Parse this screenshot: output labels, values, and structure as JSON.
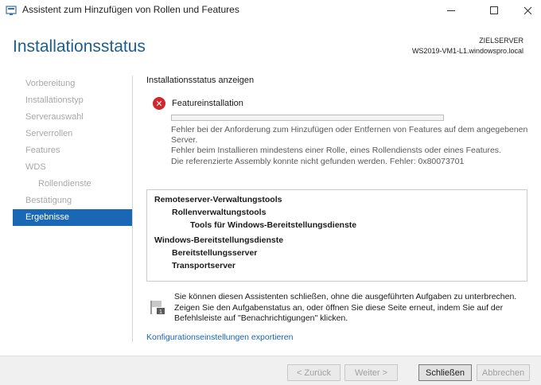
{
  "window": {
    "title": "Assistent zum Hinzufügen von Rollen und Features"
  },
  "header": {
    "page_title": "Installationsstatus",
    "server_label": "ZIELSERVER",
    "server_name": "WS2019-VM1-L1.windowspro.local"
  },
  "sidebar": {
    "items": [
      {
        "label": "Vorbereitung",
        "active": false
      },
      {
        "label": "Installationstyp",
        "active": false
      },
      {
        "label": "Serverauswahl",
        "active": false
      },
      {
        "label": "Serverrollen",
        "active": false
      },
      {
        "label": "Features",
        "active": false
      },
      {
        "label": "WDS",
        "active": false
      },
      {
        "label": "Rollendienste",
        "active": false
      },
      {
        "label": "Bestätigung",
        "active": false
      },
      {
        "label": "Ergebnisse",
        "active": true
      }
    ]
  },
  "main": {
    "section_heading": "Installationsstatus anzeigen",
    "status_label": "Featureinstallation",
    "status_icon": "error-icon",
    "progress_fraction": 0.0,
    "error_lines": [
      "Fehler bei der Anforderung zum Hinzufügen oder Entfernen von Features auf dem angegebenen",
      "Server.",
      "Fehler beim Installieren mindestens einer Rolle, eines Rollendiensts oder eines Features.",
      "Die referenzierte Assembly konnte nicht gefunden werden. Fehler: 0x80073701"
    ],
    "features": {
      "item_0": "Remoteserver-Verwaltungstools",
      "item_1": "Rollenverwaltungstools",
      "item_2": "Tools für Windows-Bereitstellungsdienste",
      "item_3": "Windows-Bereitstellungsdienste",
      "item_4": "Bereitstellungsserver",
      "item_5": "Transportserver"
    },
    "note_lines": [
      "Sie können diesen Assistenten schließen, ohne die ausgeführten Aufgaben zu unterbrechen.",
      "Zeigen Sie den Aufgabenstatus an, oder öffnen Sie diese Seite erneut, indem Sie auf der",
      "Befehlsleiste auf \"Benachrichtigungen\" klicken."
    ],
    "export_link": "Konfigurationseinstellungen exportieren"
  },
  "footer": {
    "back_label": "< Zurück",
    "next_label": "Weiter >",
    "close_label": "Schließen",
    "cancel_label": "Abbrechen"
  },
  "colors": {
    "accent": "#1a68b5",
    "title_blue": "#1e5e8e",
    "error_red": "#d0262c",
    "link_blue": "#1a64b0"
  }
}
